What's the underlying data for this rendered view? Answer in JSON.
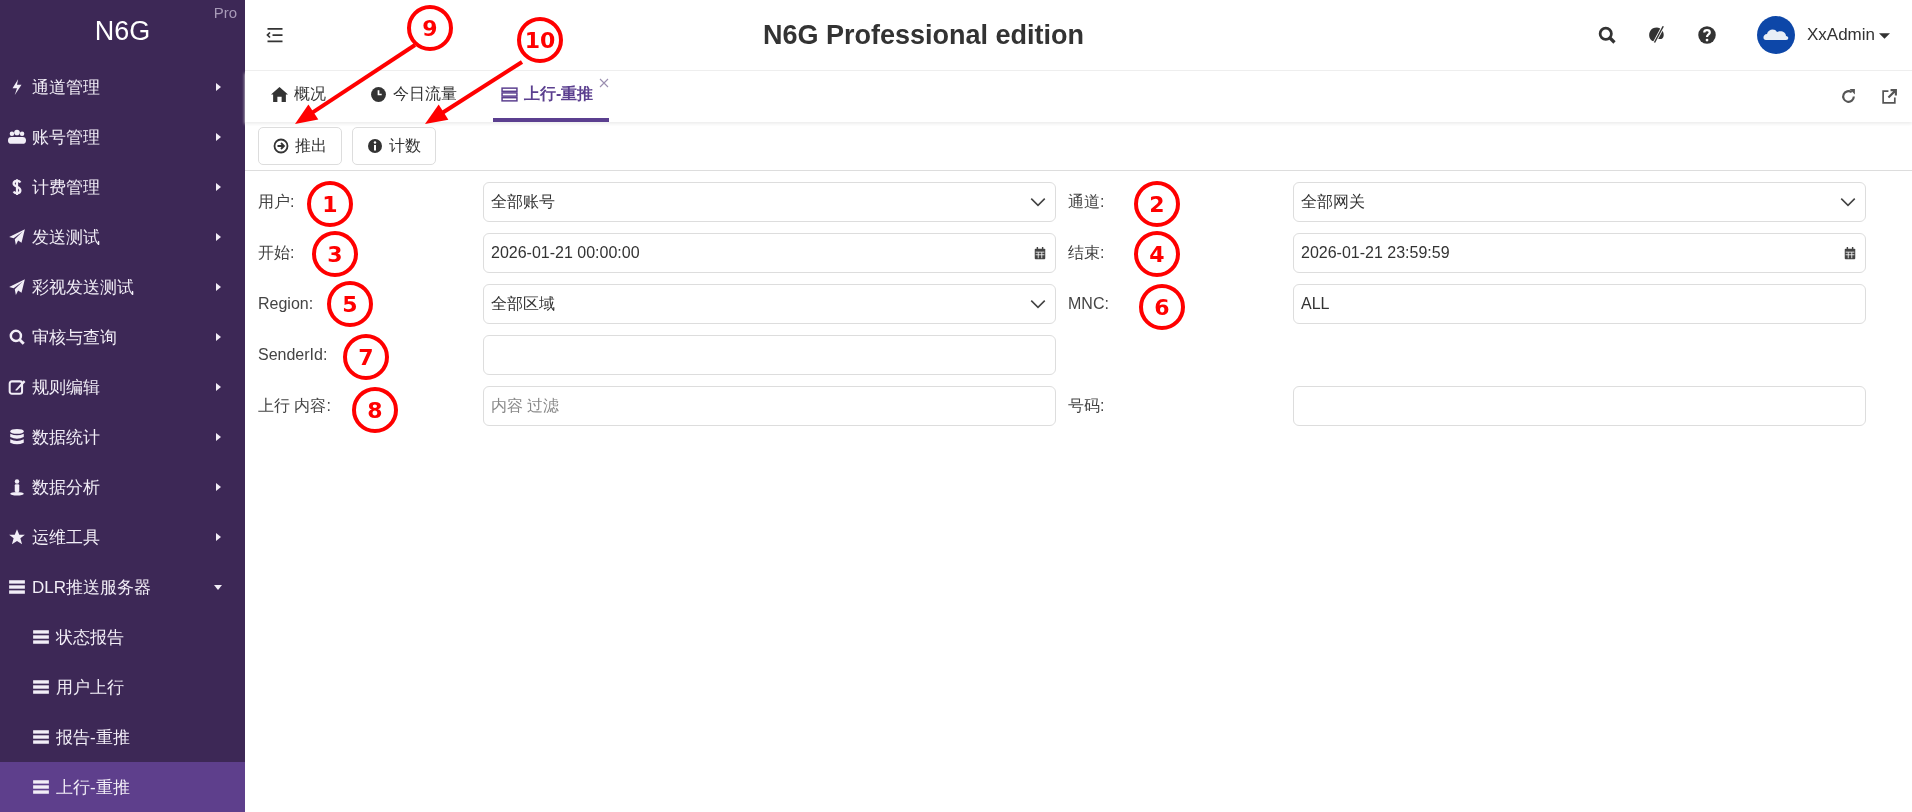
{
  "sidebar": {
    "brand": "N6G",
    "edition": "Pro",
    "items": [
      {
        "label": "通道管理",
        "expanded": false,
        "selected": false
      },
      {
        "label": "账号管理",
        "expanded": false,
        "selected": false
      },
      {
        "label": "计费管理",
        "expanded": false,
        "selected": false
      },
      {
        "label": "发送测试",
        "expanded": false,
        "selected": false
      },
      {
        "label": "彩视发送测试",
        "expanded": false,
        "selected": false
      },
      {
        "label": "审核与查询",
        "expanded": false,
        "selected": false
      },
      {
        "label": "规则编辑",
        "expanded": false,
        "selected": false
      },
      {
        "label": "数据统计",
        "expanded": false,
        "selected": false
      },
      {
        "label": "数据分析",
        "expanded": false,
        "selected": false
      },
      {
        "label": "运维工具",
        "expanded": false,
        "selected": false
      },
      {
        "label": "DLR推送服务器",
        "expanded": true,
        "selected": false,
        "children": [
          {
            "label": "状态报告",
            "selected": false
          },
          {
            "label": "用户上行",
            "selected": false
          },
          {
            "label": "报告-重推",
            "selected": false
          },
          {
            "label": "上行-重推",
            "selected": true
          }
        ]
      }
    ]
  },
  "header": {
    "title": "N6G Professional edition",
    "user": "XxAdmin"
  },
  "tabs": [
    {
      "label": "概况",
      "selected": false,
      "closable": false
    },
    {
      "label": "今日流量",
      "selected": false,
      "closable": false
    },
    {
      "label": "上行-重推",
      "selected": true,
      "closable": true
    }
  ],
  "toolbar": [
    "推出",
    "计数"
  ],
  "form": [
    {
      "left": {
        "label": "用户:",
        "kind": "select",
        "value": "全部账号"
      },
      "right": {
        "label": "通道:",
        "kind": "select",
        "value": "全部网关"
      }
    },
    {
      "left": {
        "label": "开始:",
        "kind": "date",
        "value": "2026-01-21 00:00:00"
      },
      "right": {
        "label": "结束:",
        "kind": "date",
        "value": "2026-01-21 23:59:59"
      }
    },
    {
      "left": {
        "label": "Region:",
        "kind": "select",
        "value": "全部区域"
      },
      "right": {
        "label": "MNC:",
        "kind": "text",
        "value": "ALL"
      }
    },
    {
      "left": {
        "label": "SenderId:",
        "kind": "text"
      }
    },
    {
      "left": {
        "label": "上行 内容:",
        "kind": "text",
        "placeholder": "内容 过滤"
      },
      "right": {
        "label": "号码:",
        "kind": "text"
      }
    }
  ],
  "callouts": [
    "1",
    "2",
    "3",
    "4",
    "5",
    "6",
    "7",
    "8",
    "9",
    "10"
  ]
}
